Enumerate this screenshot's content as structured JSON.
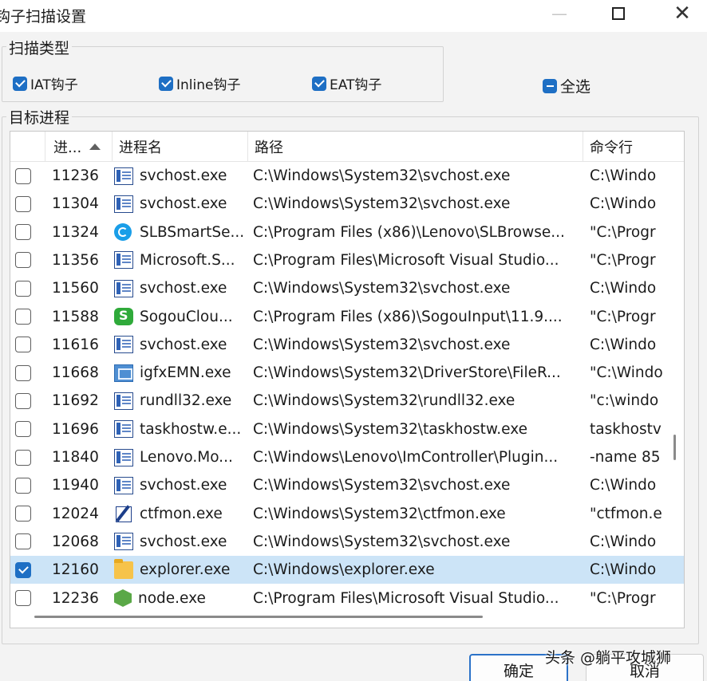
{
  "window": {
    "title": "钩子扫描设置"
  },
  "scan_type": {
    "label": "扫描类型",
    "options": [
      {
        "label": "IAT钩子",
        "checked": true
      },
      {
        "label": "Inline钩子",
        "checked": true
      },
      {
        "label": "EAT钩子",
        "checked": true
      }
    ],
    "select_all": {
      "label": "全选",
      "state": "indeterminate"
    }
  },
  "target": {
    "label": "目标进程",
    "columns": [
      "进...",
      "进程名",
      "路径",
      "命令行"
    ],
    "rows": [
      {
        "pid": "11236",
        "name": "svchost.exe",
        "icon": "service-icon",
        "path": "C:\\Windows\\System32\\svchost.exe",
        "cmd": "C:\\Windo",
        "checked": false
      },
      {
        "pid": "11304",
        "name": "svchost.exe",
        "icon": "service-icon",
        "path": "C:\\Windows\\System32\\svchost.exe",
        "cmd": "C:\\Windo",
        "checked": false
      },
      {
        "pid": "11324",
        "name": "SLBSmartSe...",
        "icon": "slb-icon",
        "path": "C:\\Program Files (x86)\\Lenovo\\SLBrowse...",
        "cmd": "\"C:\\Progr",
        "checked": false
      },
      {
        "pid": "11356",
        "name": "Microsoft.S...",
        "icon": "service-icon",
        "path": "C:\\Program Files\\Microsoft Visual Studio...",
        "cmd": "\"C:\\Progr",
        "checked": false
      },
      {
        "pid": "11560",
        "name": "svchost.exe",
        "icon": "service-icon",
        "path": "C:\\Windows\\System32\\svchost.exe",
        "cmd": "C:\\Windo",
        "checked": false
      },
      {
        "pid": "11588",
        "name": "SogouClou...",
        "icon": "sogou-icon",
        "path": "C:\\Program Files (x86)\\SogouInput\\11.9....",
        "cmd": "\"C:\\Progr",
        "checked": false
      },
      {
        "pid": "11616",
        "name": "svchost.exe",
        "icon": "service-icon",
        "path": "C:\\Windows\\System32\\svchost.exe",
        "cmd": "C:\\Windo",
        "checked": false
      },
      {
        "pid": "11668",
        "name": "igfxEMN.exe",
        "icon": "intel-graphics-icon",
        "path": "C:\\Windows\\System32\\DriverStore\\FileR...",
        "cmd": "\"C:\\Windo",
        "checked": false
      },
      {
        "pid": "11692",
        "name": "rundll32.exe",
        "icon": "service-icon",
        "path": "C:\\Windows\\System32\\rundll32.exe",
        "cmd": "\"c:\\windo",
        "checked": false
      },
      {
        "pid": "11696",
        "name": "taskhostw.e...",
        "icon": "service-icon",
        "path": "C:\\Windows\\System32\\taskhostw.exe",
        "cmd": "taskhostv",
        "checked": false
      },
      {
        "pid": "11840",
        "name": "Lenovo.Mo...",
        "icon": "service-icon",
        "path": "C:\\Windows\\Lenovo\\ImController\\Plugin...",
        "cmd": "-name 85",
        "checked": false
      },
      {
        "pid": "11940",
        "name": "svchost.exe",
        "icon": "service-icon",
        "path": "C:\\Windows\\System32\\svchost.exe",
        "cmd": "C:\\Windo",
        "checked": false
      },
      {
        "pid": "12024",
        "name": "ctfmon.exe",
        "icon": "ctfmon-pen-icon",
        "path": "C:\\Windows\\System32\\ctfmon.exe",
        "cmd": "\"ctfmon.e",
        "checked": false
      },
      {
        "pid": "12068",
        "name": "svchost.exe",
        "icon": "service-icon",
        "path": "C:\\Windows\\System32\\svchost.exe",
        "cmd": "C:\\Windo",
        "checked": false
      },
      {
        "pid": "12160",
        "name": "explorer.exe",
        "icon": "folder-icon",
        "path": "C:\\Windows\\explorer.exe",
        "cmd": "C:\\Windo",
        "checked": true
      },
      {
        "pid": "12236",
        "name": "node.exe",
        "icon": "node-icon",
        "path": "C:\\Program Files\\Microsoft Visual Studio...",
        "cmd": "\"C:\\Progr",
        "checked": false
      }
    ]
  },
  "buttons": {
    "ok": "确定",
    "cancel": "取消"
  },
  "watermark": "头条 @躺平攻城狮",
  "colors": {
    "accent": "#1e6fc4",
    "selected_row": "#cce4f7"
  }
}
